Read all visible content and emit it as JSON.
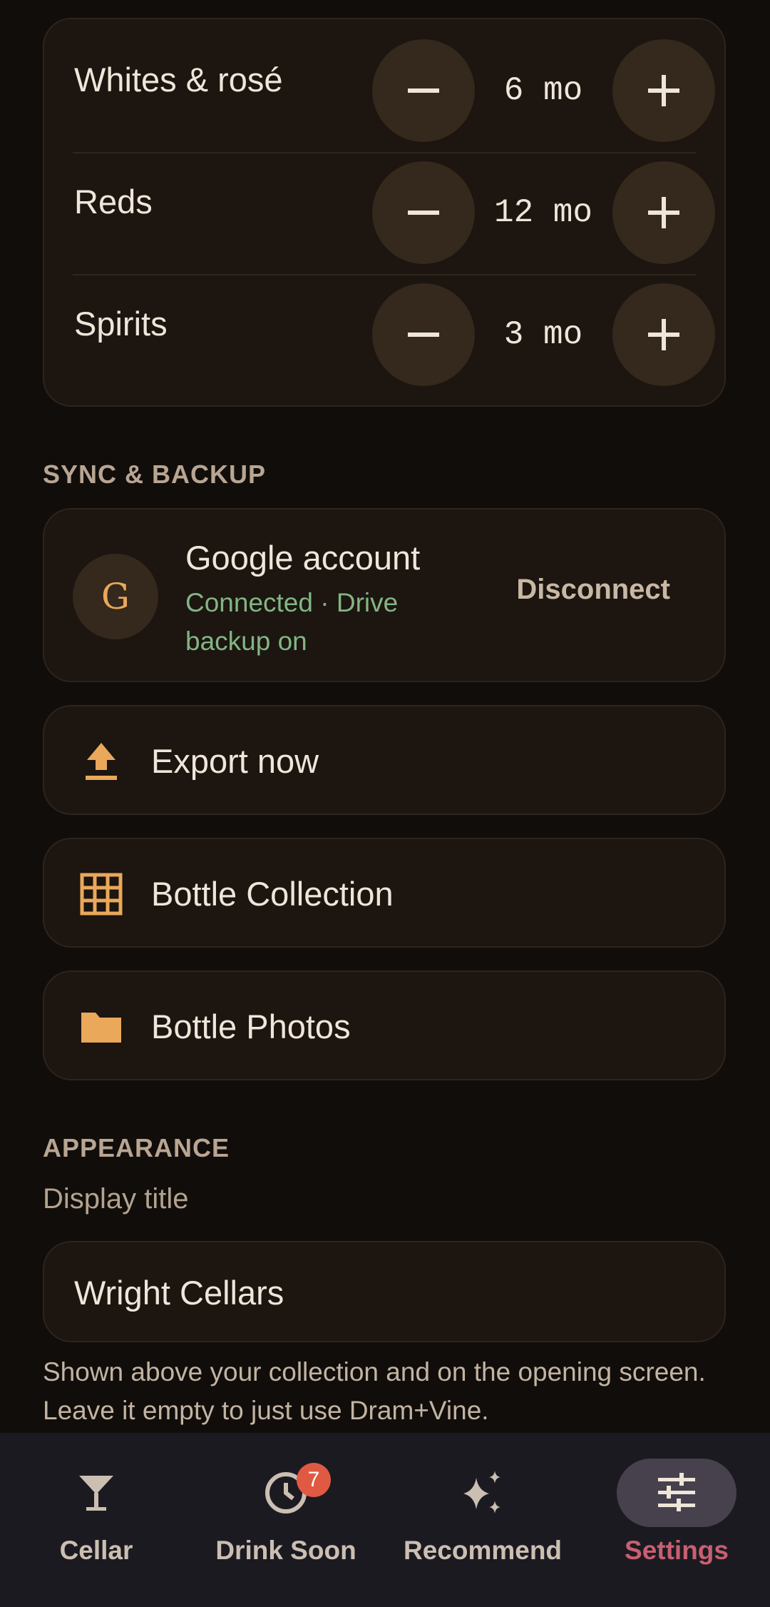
{
  "reminders": {
    "rows": [
      {
        "label": "Whites & rosé",
        "value": "6 mo"
      },
      {
        "label": "Reds",
        "value": "12 mo"
      },
      {
        "label": "Spirits",
        "value": "3 mo"
      }
    ]
  },
  "sync": {
    "section_title": "SYNC & BACKUP",
    "google": {
      "avatar_letter": "G",
      "title": "Google account",
      "status": "Connected · Drive backup on",
      "disconnect_label": "Disconnect"
    },
    "export_label": "Export now",
    "collection_label": "Bottle Collection",
    "photos_label": "Bottle Photos"
  },
  "appearance": {
    "section_title": "APPEARANCE",
    "display_title_label": "Display title",
    "display_title_value": "Wright Cellars",
    "helper_text": "Shown above your collection and on the opening screen. Leave it empty to just use Dram+Vine."
  },
  "nav": {
    "items": [
      {
        "label": "Cellar",
        "icon": "cocktail-glass-icon"
      },
      {
        "label": "Drink Soon",
        "icon": "clock-icon",
        "badge": "7"
      },
      {
        "label": "Recommend",
        "icon": "sparkle-icon"
      },
      {
        "label": "Settings",
        "icon": "tune-icon",
        "active": true
      }
    ]
  },
  "colors": {
    "background": "#110d0a",
    "card": "#1c1510",
    "accent": "#e9a85a",
    "status_green": "#82b584",
    "active_nav": "#c85f72",
    "badge": "#e05a43"
  }
}
